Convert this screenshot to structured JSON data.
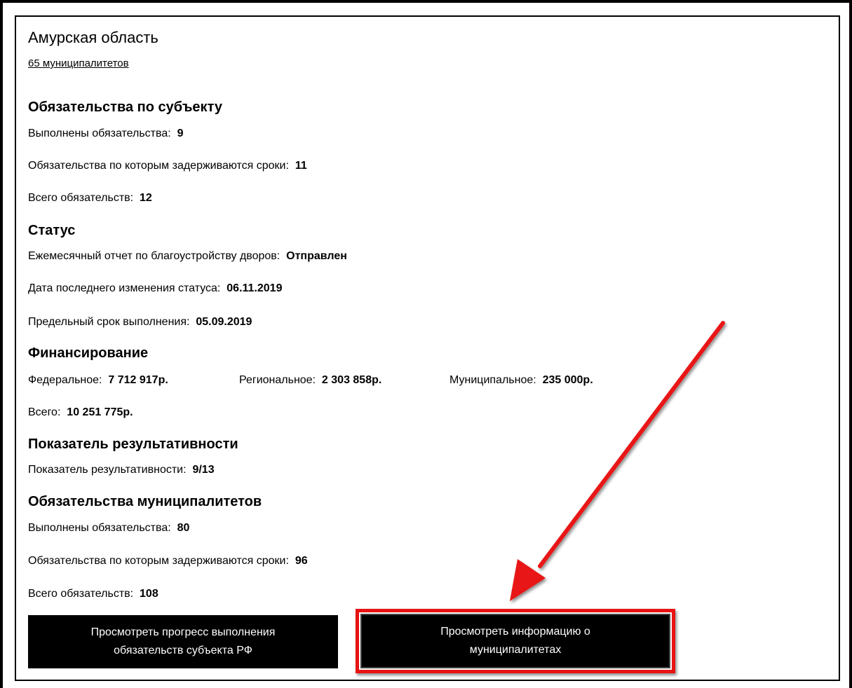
{
  "region": {
    "title": "Амурская область",
    "municipalities_link": "65 муниципалитетов"
  },
  "subject_obligations": {
    "heading": "Обязательства по субъекту",
    "done_label": "Выполнены обязательства:",
    "done_value": "9",
    "delayed_label": "Обязательства по которым задерживаются сроки:",
    "delayed_value": "11",
    "total_label": "Всего обязательств:",
    "total_value": "12"
  },
  "status": {
    "heading": "Статус",
    "report_label": "Ежемесячный отчет по благоустройству дворов:",
    "report_value": "Отправлен",
    "changed_label": "Дата последнего изменения статуса:",
    "changed_value": "06.11.2019",
    "deadline_label": "Предельный срок выполнения:",
    "deadline_value": "05.09.2019"
  },
  "financing": {
    "heading": "Финансирование",
    "federal_label": "Федеральное:",
    "federal_value": "7 712 917р.",
    "regional_label": "Региональное:",
    "regional_value": "2 303 858р.",
    "municipal_label": "Муниципальное:",
    "municipal_value": "235 000р.",
    "total_label": "Всего:",
    "total_value": "10 251 775р."
  },
  "performance": {
    "heading": "Показатель результативности",
    "label": "Показатель результативности:",
    "value": "9/13"
  },
  "municipal_obligations": {
    "heading": "Обязательства муниципалитетов",
    "done_label": "Выполнены обязательства:",
    "done_value": "80",
    "delayed_label": "Обязательства по которым задерживаются сроки:",
    "delayed_value": "96",
    "total_label": "Всего обязательств:",
    "total_value": "108"
  },
  "buttons": {
    "progress_line1": "Просмотреть прогресс выполнения",
    "progress_line2": "обязательств субъекта РФ",
    "info_line1": "Просмотреть информацию о",
    "info_line2": "муниципалитетах"
  },
  "colors": {
    "highlight": "#e81313",
    "button_bg": "#000000",
    "button_text": "#ffffff"
  },
  "icons": {
    "annotation": "red-arrow"
  }
}
